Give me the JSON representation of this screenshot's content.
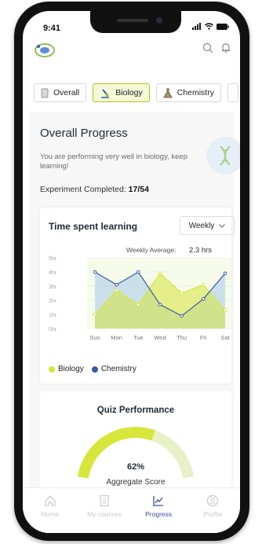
{
  "status_bar": {
    "time": "9:41"
  },
  "header": {
    "logo_icon": "biology-logo-icon",
    "search_icon": "search-icon",
    "bell_icon": "bell-icon"
  },
  "tabs": [
    {
      "label": "Overall",
      "icon": "beaker-icon",
      "active": false
    },
    {
      "label": "Biology",
      "icon": "microscope-icon",
      "active": true
    },
    {
      "label": "Chemistry",
      "icon": "flask-icon",
      "active": false
    }
  ],
  "progress": {
    "title": "Overall Progress",
    "description": "You are performing very well in biology, keep learning!",
    "experiments_label": "Experiment Completed:",
    "experiments_value": "17/54"
  },
  "chart_card": {
    "title": "Time spent learning",
    "period_select": "Weekly",
    "average_label": "Weekly Average:",
    "average_value": "2.3 hrs"
  },
  "chart_data": {
    "type": "area",
    "title": "Time spent learning",
    "categories": [
      "Sun",
      "Mon",
      "Tue",
      "Wed",
      "Thu",
      "Fri",
      "Sat"
    ],
    "y_tick_labels": [
      "0hr",
      "1hr",
      "2hr",
      "3hr",
      "4hr",
      "5hr"
    ],
    "ylim": [
      0,
      5
    ],
    "series": [
      {
        "name": "Biology",
        "values": [
          1.0,
          2.7,
          1.7,
          3.9,
          2.5,
          3.1,
          1.3
        ],
        "color": "#d7e63a"
      },
      {
        "name": "Chemistry",
        "values": [
          4.0,
          3.1,
          4.0,
          1.7,
          0.9,
          2.1,
          3.9
        ],
        "color": "#3b5ba9"
      }
    ],
    "legend_position": "bottom-left",
    "grid": true
  },
  "quiz": {
    "title": "Quiz Performance",
    "percent": "62%",
    "percent_value": 62,
    "label": "Aggregate Score"
  },
  "bottom_nav": [
    {
      "label": "Home",
      "icon": "home-icon",
      "active": false
    },
    {
      "label": "My courses",
      "icon": "courses-icon",
      "active": false
    },
    {
      "label": "Progress",
      "icon": "progress-chart-icon",
      "active": true
    },
    {
      "label": "Profile",
      "icon": "profile-icon",
      "active": false
    }
  ],
  "colors": {
    "accent": "#3a4fa0",
    "biology": "#d7e63a",
    "chemistry": "#3b5ba9",
    "gauge_track": "#e8f0c8"
  }
}
